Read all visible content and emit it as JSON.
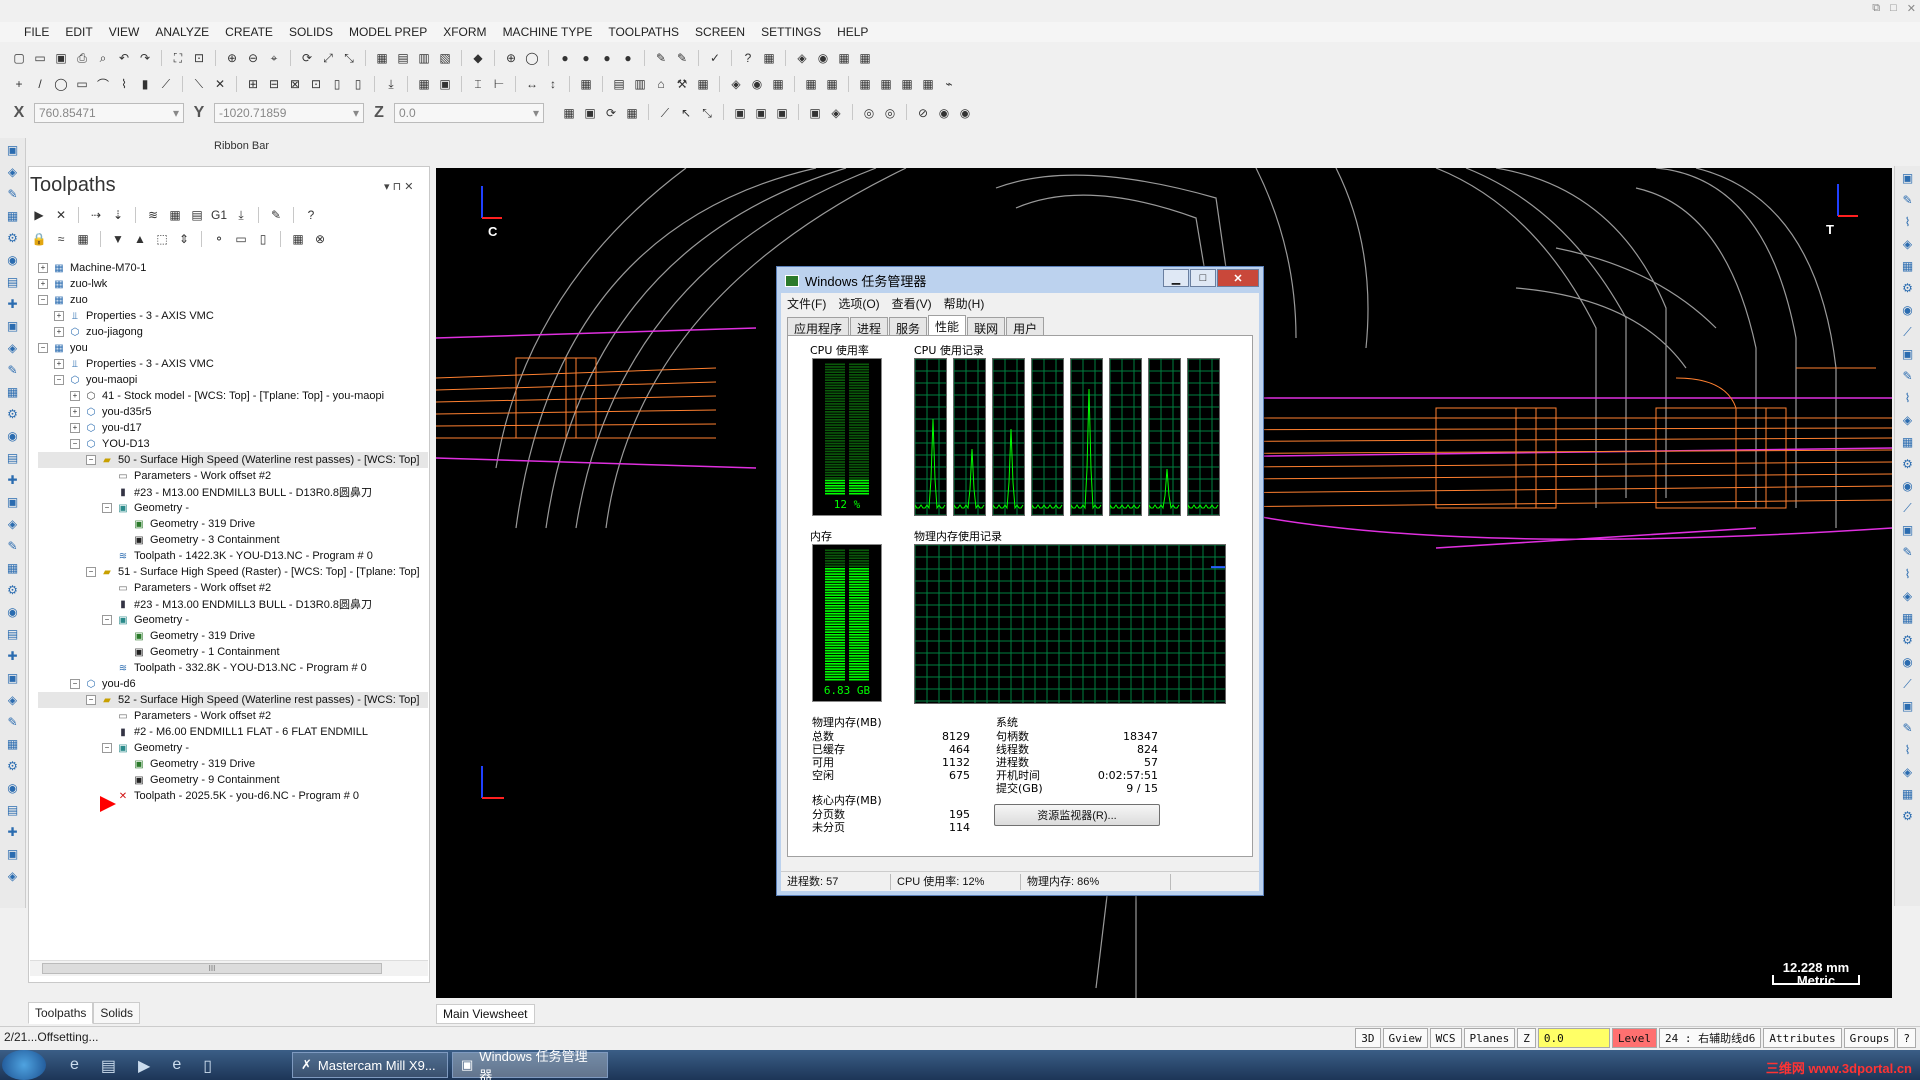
{
  "menu": [
    "FILE",
    "EDIT",
    "VIEW",
    "ANALYZE",
    "CREATE",
    "SOLIDS",
    "MODEL PREP",
    "XFORM",
    "MACHINE TYPE",
    "TOOLPATHS",
    "SCREEN",
    "SETTINGS",
    "HELP"
  ],
  "coords": {
    "x_label": "X",
    "x_value": "760.85471",
    "y_label": "Y",
    "y_value": "-1020.71859",
    "z_label": "Z",
    "z_value": "0.0"
  },
  "ribbon_label": "Ribbon Bar",
  "panel": {
    "title": "Toolpaths",
    "pin": "▾ ⊓ ✕",
    "tree": [
      {
        "text": "Machine-M70-1",
        "indent": 0,
        "icon": "machine-group-icon",
        "exp": "+"
      },
      {
        "text": "zuo-lwk",
        "indent": 0,
        "icon": "machine-group-icon",
        "exp": "+"
      },
      {
        "text": "zuo",
        "indent": 0,
        "icon": "machine-group-icon",
        "exp": "-"
      },
      {
        "text": "Properties - 3 - AXIS VMC",
        "indent": 1,
        "icon": "properties-icon",
        "exp": "+"
      },
      {
        "text": "zuo-jiagong",
        "indent": 1,
        "icon": "toolpath-group-icon",
        "exp": "+"
      },
      {
        "text": "you",
        "indent": 0,
        "icon": "machine-group-icon",
        "exp": "-"
      },
      {
        "text": "Properties - 3 - AXIS VMC",
        "indent": 1,
        "icon": "properties-icon",
        "exp": "+"
      },
      {
        "text": "you-maopi",
        "indent": 1,
        "icon": "toolpath-group-icon",
        "exp": "-"
      },
      {
        "text": "41 - Stock model - [WCS: Top] - [Tplane: Top] - you-maopi",
        "indent": 2,
        "icon": "stock-model-icon",
        "exp": "+"
      },
      {
        "text": "you-d35r5",
        "indent": 2,
        "icon": "toolpath-group-icon",
        "exp": "+"
      },
      {
        "text": "you-d17",
        "indent": 2,
        "icon": "toolpath-group-icon",
        "exp": "+"
      },
      {
        "text": "YOU-D13",
        "indent": 2,
        "icon": "toolpath-group-icon",
        "exp": "-"
      },
      {
        "text": "50 - Surface High Speed (Waterline rest passes) - [WCS: Top]",
        "indent": 3,
        "icon": "operation-folder-icon",
        "exp": "-",
        "sel": true
      },
      {
        "text": "Parameters - Work offset #2",
        "indent": 4,
        "icon": "parameters-icon",
        "exp": ""
      },
      {
        "text": "#23 - M13.00 ENDMILL3 BULL - D13R0.8圆鼻刀",
        "indent": 4,
        "icon": "tool-icon",
        "exp": ""
      },
      {
        "text": "Geometry -",
        "indent": 4,
        "icon": "geometry-icon",
        "exp": "-"
      },
      {
        "text": "Geometry - 319 Drive",
        "indent": 5,
        "icon": "geometry-drive-icon",
        "exp": ""
      },
      {
        "text": "Geometry - 3 Containment",
        "indent": 5,
        "icon": "geometry-containment-icon",
        "exp": ""
      },
      {
        "text": "Toolpath - 1422.3K - YOU-D13.NC - Program # 0",
        "indent": 4,
        "icon": "toolpath-icon",
        "exp": ""
      },
      {
        "text": "51 - Surface High Speed (Raster) - [WCS: Top] - [Tplane: Top]",
        "indent": 3,
        "icon": "operation-folder-icon",
        "exp": "-"
      },
      {
        "text": "Parameters - Work offset #2",
        "indent": 4,
        "icon": "parameters-icon",
        "exp": ""
      },
      {
        "text": "#23 - M13.00 ENDMILL3 BULL - D13R0.8圆鼻刀",
        "indent": 4,
        "icon": "tool-icon",
        "exp": ""
      },
      {
        "text": "Geometry -",
        "indent": 4,
        "icon": "geometry-icon",
        "exp": "-"
      },
      {
        "text": "Geometry - 319 Drive",
        "indent": 5,
        "icon": "geometry-drive-icon",
        "exp": ""
      },
      {
        "text": "Geometry - 1 Containment",
        "indent": 5,
        "icon": "geometry-containment-icon",
        "exp": ""
      },
      {
        "text": "Toolpath - 332.8K - YOU-D13.NC - Program # 0",
        "indent": 4,
        "icon": "toolpath-icon",
        "exp": ""
      },
      {
        "text": "you-d6",
        "indent": 2,
        "icon": "toolpath-group-icon",
        "exp": "-"
      },
      {
        "text": "52 - Surface High Speed (Waterline rest passes) - [WCS: Top]",
        "indent": 3,
        "icon": "operation-folder-icon",
        "exp": "-",
        "sel": true
      },
      {
        "text": "Parameters - Work offset #2",
        "indent": 4,
        "icon": "parameters-icon",
        "exp": ""
      },
      {
        "text": "#2 - M6.00 ENDMILL1 FLAT - 6 FLAT ENDMILL",
        "indent": 4,
        "icon": "tool-icon",
        "exp": ""
      },
      {
        "text": "Geometry -",
        "indent": 4,
        "icon": "geometry-icon",
        "exp": "-"
      },
      {
        "text": "Geometry - 319 Drive",
        "indent": 5,
        "icon": "geometry-drive-icon",
        "exp": ""
      },
      {
        "text": "Geometry - 9 Containment",
        "indent": 5,
        "icon": "geometry-containment-icon",
        "exp": ""
      },
      {
        "text": "Toolpath - 2025.5K - you-d6.NC - Program # 0",
        "indent": 4,
        "icon": "toolpath-dirty-icon",
        "exp": ""
      }
    ],
    "tab_toolpaths": "Toolpaths",
    "tab_solids": "Solids",
    "scroll_grip": "III"
  },
  "viewport": {
    "tab": "Main Viewsheet",
    "scale_value": "12.228 mm",
    "scale_unit": "Metric",
    "axis_c": "C",
    "axis_t": "T"
  },
  "taskmgr": {
    "title": "Windows 任务管理器",
    "menu": [
      "文件(F)",
      "选项(O)",
      "查看(V)",
      "帮助(H)"
    ],
    "tabs": [
      "应用程序",
      "进程",
      "服务",
      "性能",
      "联网",
      "用户"
    ],
    "active_tab": 3,
    "cpu_usage_label": "CPU 使用率",
    "cpu_usage_value": "12 %",
    "cpu_usage_pct": 12,
    "cpu_history_label": "CPU 使用记录",
    "cpu_cores": 8,
    "mem_label": "内存",
    "mem_value": "6.83 GB",
    "mem_pct": 86,
    "mem_history_label": "物理内存使用记录",
    "phys_mem": {
      "title": "物理内存(MB)",
      "rows": [
        [
          "总数",
          "8129"
        ],
        [
          "已缓存",
          "464"
        ],
        [
          "可用",
          "1132"
        ],
        [
          "空闲",
          "675"
        ]
      ]
    },
    "kernel_mem": {
      "title": "核心内存(MB)",
      "rows": [
        [
          "分页数",
          "195"
        ],
        [
          "未分页",
          "114"
        ]
      ]
    },
    "system": {
      "title": "系统",
      "rows": [
        [
          "句柄数",
          "18347"
        ],
        [
          "线程数",
          "824"
        ],
        [
          "进程数",
          "57"
        ],
        [
          "开机时间",
          "0:02:57:51"
        ],
        [
          "提交(GB)",
          "9 / 15"
        ]
      ]
    },
    "resmon_button": "资源监视器(R)...",
    "status": [
      "进程数: 57",
      "CPU 使用率: 12%",
      "物理内存: 86%"
    ],
    "colors": {
      "graph_green": "#00ff00",
      "grid": "#008040"
    }
  },
  "statusbar": {
    "left": "2/21...Offsetting...",
    "cells": [
      "3D",
      "Gview",
      "WCS",
      "Planes",
      "Z",
      "0.0",
      "Level",
      "24 : 右辅助线d6",
      "Attributes",
      "Groups",
      "?"
    ]
  },
  "taskbar": {
    "items": [
      "Mastercam Mill X9...",
      "Windows 任务管理器"
    ],
    "tray": "三维网 www.3dportal.cn"
  }
}
